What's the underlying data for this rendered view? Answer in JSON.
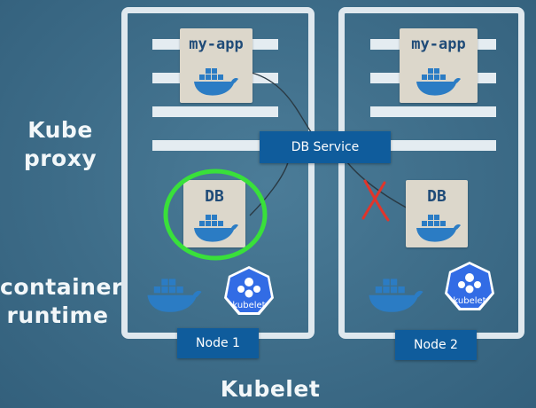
{
  "labels": {
    "kube_proxy": "Kube proxy",
    "container_runtime": "container runtime",
    "kubelet_bottom": "Kubelet"
  },
  "nodes": [
    {
      "label": "Node 1"
    },
    {
      "label": "Node 2"
    }
  ],
  "apps": {
    "app": "my-app",
    "db": "DB"
  },
  "service": {
    "label": "DB Service"
  },
  "kubelet_logo_text": "kubelet",
  "colors": {
    "background": "#3f6f8c",
    "highlight_circle": "#39e03a",
    "cross": "#e0352b",
    "service_blue": "#0f5c9c",
    "docker_blue": "#2b7cc4"
  },
  "icons": [
    "docker-whale-icon",
    "kubelet-logo-icon",
    "cross-icon",
    "highlight-circle"
  ]
}
